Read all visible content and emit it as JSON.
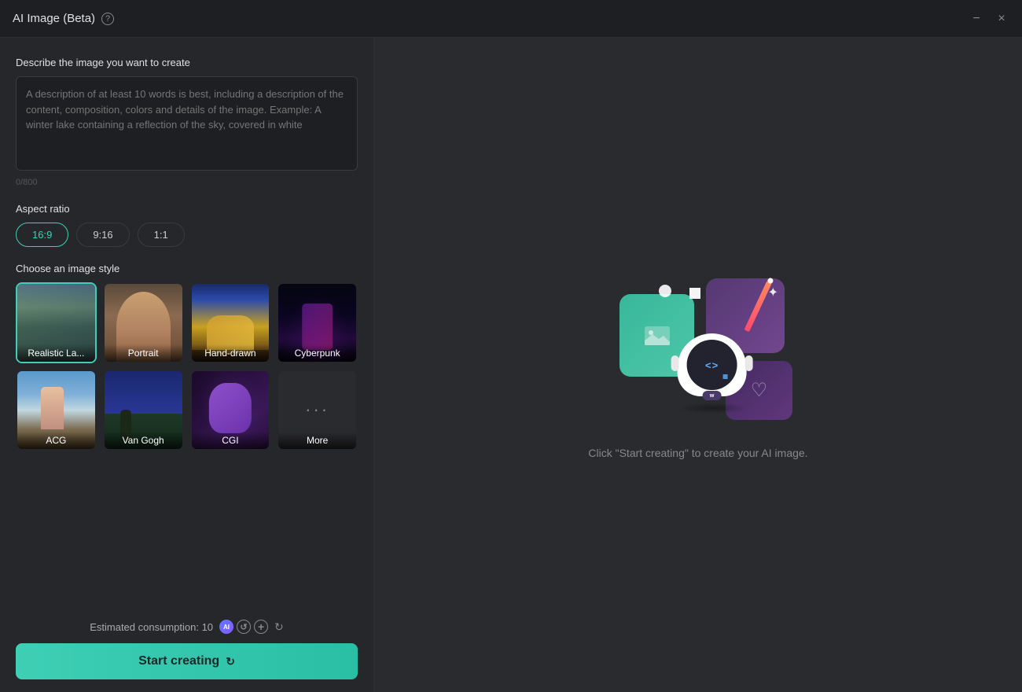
{
  "window": {
    "title": "AI Image (Beta)",
    "minimize_label": "−",
    "close_label": "×"
  },
  "left_panel": {
    "description_label": "Describe the image you want to create",
    "textarea_placeholder": "A description of at least 10 words is best, including a description of the content, composition, colors and details of the image. Example: A winter lake containing a reflection of the sky, covered in white",
    "char_count": "0/800",
    "aspect_ratio_label": "Aspect ratio",
    "aspect_options": [
      {
        "label": "16:9",
        "value": "16:9",
        "active": true
      },
      {
        "label": "9:16",
        "value": "9:16",
        "active": false
      },
      {
        "label": "1:1",
        "value": "1:1",
        "active": false
      }
    ],
    "style_label": "Choose an image style",
    "styles": [
      {
        "label": "Realistic La...",
        "id": "realistic"
      },
      {
        "label": "Portrait",
        "id": "portrait"
      },
      {
        "label": "Hand-drawn",
        "id": "hand-drawn"
      },
      {
        "label": "Cyberpunk",
        "id": "cyberpunk"
      },
      {
        "label": "ACG",
        "id": "acg"
      },
      {
        "label": "Van Gogh",
        "id": "van-gogh"
      },
      {
        "label": "CGI",
        "id": "cgi"
      },
      {
        "label": "More",
        "id": "more"
      }
    ],
    "consumption_label": "Estimated consumption: 10",
    "start_button_label": "Start creating"
  },
  "right_panel": {
    "caption": "Click \"Start creating\" to create your AI image."
  }
}
